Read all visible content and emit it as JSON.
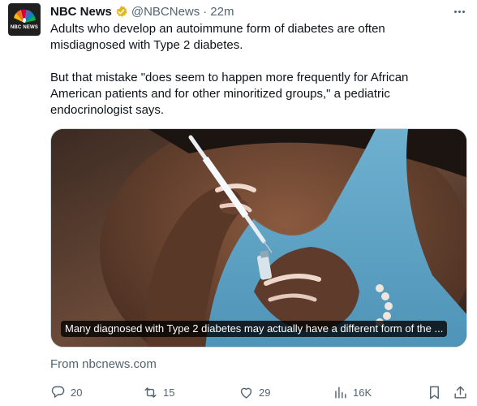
{
  "tweet": {
    "author_name": "NBC News",
    "handle": "@NBCNews",
    "separator": "·",
    "time": "22m",
    "avatar_text": "NBC NEWS",
    "paragraphs": [
      "Adults who develop an autoimmune form of diabetes are often misdiagnosed with Type 2 diabetes.",
      "But that mistake \"does seem to happen more frequently for African American patients and for other minoritized groups,\" a pediatric endocrinologist says."
    ],
    "media_caption": "Many diagnosed with Type 2 diabetes may actually have a different form of the ...",
    "source": "From nbcnews.com"
  },
  "actions": {
    "reply_count": "20",
    "retweet_count": "15",
    "like_count": "29",
    "views_count": "16K"
  },
  "icons": {
    "avatar": "nbc-peacock-logo",
    "verified": "gold-verified-badge-icon",
    "more": "more-options-icon",
    "reply": "reply-icon",
    "retweet": "retweet-icon",
    "like": "heart-icon",
    "views": "views-chart-icon",
    "bookmark": "bookmark-icon",
    "share": "share-icon"
  },
  "colors": {
    "text_primary": "#0f1419",
    "text_secondary": "#536471",
    "verified_gold": "#e2b719",
    "border": "#cfd9de"
  }
}
